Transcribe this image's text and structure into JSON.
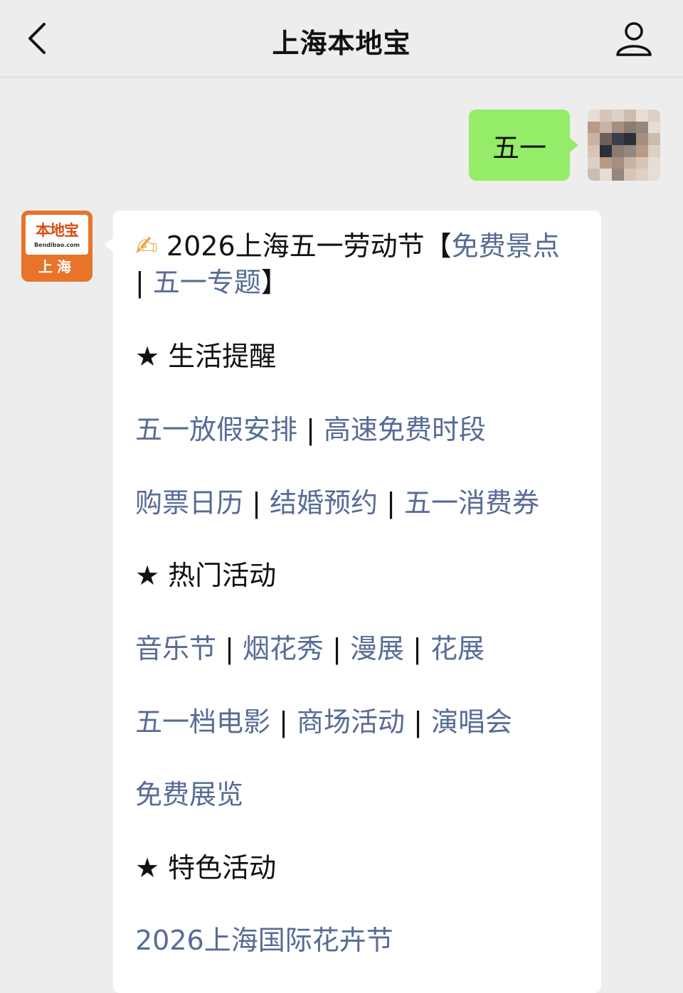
{
  "header": {
    "title": "上海本地宝"
  },
  "outgoing": {
    "text": "五一"
  },
  "bot": {
    "logo_cn": "本地宝",
    "logo_en": "Bendibao.com",
    "logo_city": "上海"
  },
  "message": {
    "headline": {
      "emoji": "✍",
      "text": " 2026上海五一劳动节【",
      "link1": "免费景点",
      "sep": " | ",
      "link2": "五一专题",
      "end": "】"
    },
    "sections": [
      {
        "star": "★",
        "heading": " 生活提醒",
        "rows": [
          [
            "五一放假安排",
            "高速免费时段"
          ],
          [
            "购票日历",
            "结婚预约",
            "五一消费券"
          ]
        ]
      },
      {
        "star": "★",
        "heading": " 热门活动",
        "rows": [
          [
            "音乐节",
            "烟花秀",
            "漫展",
            "花展"
          ],
          [
            "五一档电影",
            "商场活动",
            "演唱会"
          ],
          [
            "免费展览"
          ]
        ]
      },
      {
        "star": "★",
        "heading": " 特色活动",
        "rows": [
          [
            "2026上海国际花卉节"
          ]
        ]
      }
    ],
    "separator": " | "
  },
  "colors": {
    "background": "#ededed",
    "outgoing_bubble": "#95ec69",
    "link": "#576b95",
    "bot_avatar": "#e8742a"
  },
  "icons": {
    "back": "chevron-left-icon",
    "profile": "person-icon"
  }
}
